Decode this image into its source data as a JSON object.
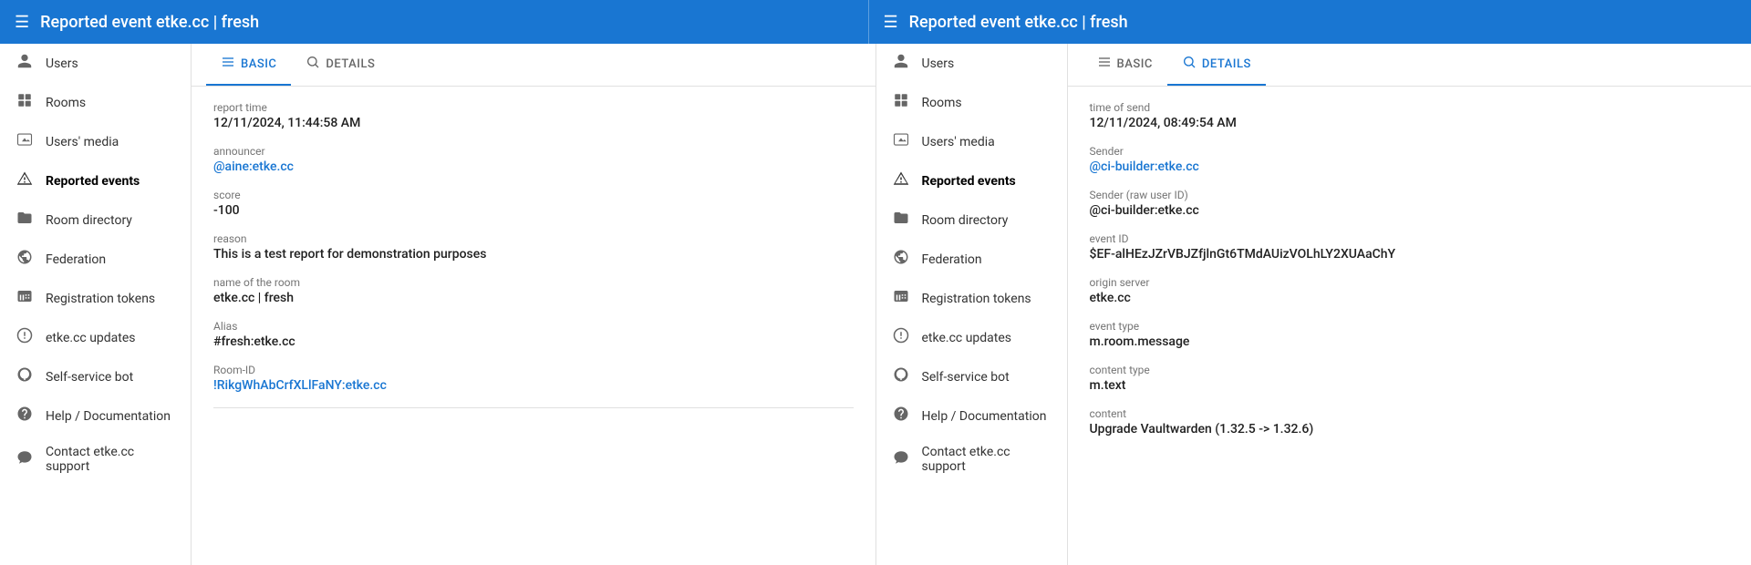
{
  "topbar": {
    "left_title": "Reported event etke.cc | fresh",
    "right_title": "Reported event etke.cc | fresh"
  },
  "sidebar_left": {
    "items": [
      {
        "id": "users",
        "label": "Users",
        "icon": "👤"
      },
      {
        "id": "rooms",
        "label": "Rooms",
        "icon": "▦"
      },
      {
        "id": "users-media",
        "label": "Users' media",
        "icon": "🖼"
      },
      {
        "id": "reported-events",
        "label": "Reported events",
        "icon": "⚠",
        "active": true
      },
      {
        "id": "room-directory",
        "label": "Room directory",
        "icon": "📁"
      },
      {
        "id": "federation",
        "label": "Federation",
        "icon": "☁"
      },
      {
        "id": "registration-tokens",
        "label": "Registration tokens",
        "icon": "🔢"
      },
      {
        "id": "updates",
        "label": "etke.cc updates",
        "icon": "❗"
      },
      {
        "id": "self-service-bot",
        "label": "Self-service bot",
        "icon": "👤"
      },
      {
        "id": "help-doc",
        "label": "Help / Documentation",
        "icon": "❓"
      },
      {
        "id": "contact-support",
        "label": "Contact etke.cc support",
        "icon": "💬"
      }
    ]
  },
  "sidebar_right": {
    "items": [
      {
        "id": "users",
        "label": "Users",
        "icon": "👤"
      },
      {
        "id": "rooms",
        "label": "Rooms",
        "icon": "▦"
      },
      {
        "id": "users-media",
        "label": "Users' media",
        "icon": "🖼"
      },
      {
        "id": "reported-events",
        "label": "Reported events",
        "icon": "⚠",
        "active": true
      },
      {
        "id": "room-directory",
        "label": "Room directory",
        "icon": "📁"
      },
      {
        "id": "federation",
        "label": "Federation",
        "icon": "☁"
      },
      {
        "id": "registration-tokens",
        "label": "Registration tokens",
        "icon": "🔢"
      },
      {
        "id": "updates",
        "label": "etke.cc updates",
        "icon": "❗"
      },
      {
        "id": "self-service-bot",
        "label": "Self-service bot",
        "icon": "👤"
      },
      {
        "id": "help-doc",
        "label": "Help / Documentation",
        "icon": "❓"
      },
      {
        "id": "contact-support",
        "label": "Contact etke.cc support",
        "icon": "💬"
      }
    ]
  },
  "left_panel": {
    "tabs": [
      {
        "id": "basic",
        "label": "BASIC",
        "active": true,
        "icon": "☰"
      },
      {
        "id": "details",
        "label": "DETAILS",
        "active": false,
        "icon": "🔍"
      }
    ],
    "basic": {
      "report_time_label": "report time",
      "report_time_value": "12/11/2024, 11:44:58 AM",
      "announcer_label": "announcer",
      "announcer_value": "@aine:etke.cc",
      "score_label": "score",
      "score_value": "-100",
      "reason_label": "reason",
      "reason_value": "This is a test report for demonstration purposes",
      "room_name_label": "name of the room",
      "room_name_value": "etke.cc | fresh",
      "alias_label": "Alias",
      "alias_value": "#fresh:etke.cc",
      "room_id_label": "Room-ID",
      "room_id_value": "!RikgWhAbCrfXLlFaNY:etke.cc"
    }
  },
  "right_panel": {
    "tabs": [
      {
        "id": "basic",
        "label": "BASIC",
        "active": false,
        "icon": "☰"
      },
      {
        "id": "details",
        "label": "DETAILS",
        "active": true,
        "icon": "🔍"
      }
    ],
    "details": {
      "time_of_send_label": "time of send",
      "time_of_send_value": "12/11/2024, 08:49:54 AM",
      "sender_label": "Sender",
      "sender_value": "@ci-builder:etke.cc",
      "sender_raw_label": "Sender (raw user ID)",
      "sender_raw_value": "@ci-builder:etke.cc",
      "event_id_label": "event ID",
      "event_id_value": "$EF-alHEzJZrVBJZfjlnGt6TMdAUizVOLhLY2XUAaChY",
      "origin_server_label": "origin server",
      "origin_server_value": "etke.cc",
      "event_type_label": "event type",
      "event_type_value": "m.room.message",
      "content_type_label": "content type",
      "content_type_value": "m.text",
      "content_label": "content",
      "content_value": "Upgrade Vaultwarden (1.32.5 -> 1.32.6)"
    }
  }
}
